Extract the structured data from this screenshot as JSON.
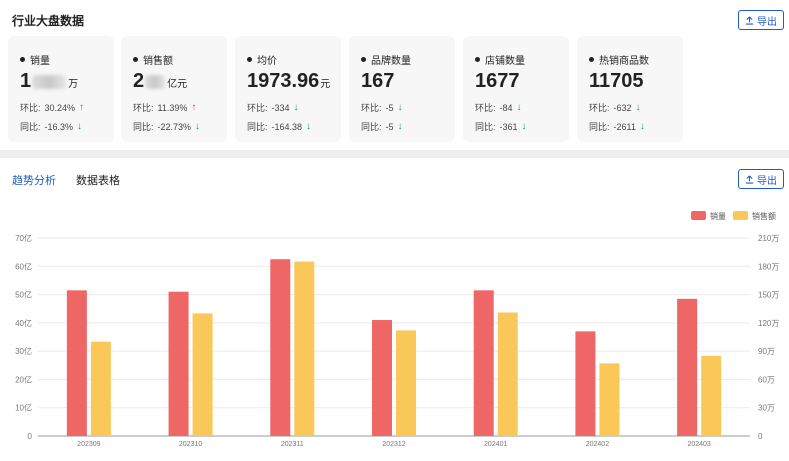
{
  "overview": {
    "title": "行业大盘数据",
    "export_label": "导出",
    "metrics": [
      {
        "name": "销量",
        "value_prefix": "1",
        "value_suffix": "",
        "unit": "万",
        "masked": true,
        "hb_label": "环比:",
        "hb_value": "30.24%",
        "hb_dir": "up",
        "tb_label": "同比:",
        "tb_value": "-16.3%",
        "tb_dir": "down"
      },
      {
        "name": "销售额",
        "value_prefix": "2",
        "value_suffix": "",
        "unit": "亿元",
        "masked": true,
        "hb_label": "环比:",
        "hb_value": "11.39%",
        "hb_dir": "up",
        "tb_label": "同比:",
        "tb_value": "-22.73%",
        "tb_dir": "down"
      },
      {
        "name": "均价",
        "value_prefix": "1973.96",
        "value_suffix": "",
        "unit": "元",
        "masked": false,
        "hb_label": "环比:",
        "hb_value": "-334",
        "hb_dir": "down",
        "tb_label": "同比:",
        "tb_value": "-164.38",
        "tb_dir": "down"
      },
      {
        "name": "品牌数量",
        "value_prefix": "167",
        "value_suffix": "",
        "unit": "",
        "masked": false,
        "hb_label": "环比:",
        "hb_value": "-5",
        "hb_dir": "down",
        "tb_label": "同比:",
        "tb_value": "-5",
        "tb_dir": "down"
      },
      {
        "name": "店铺数量",
        "value_prefix": "1677",
        "value_suffix": "",
        "unit": "",
        "masked": false,
        "hb_label": "环比:",
        "hb_value": "-84",
        "hb_dir": "down",
        "tb_label": "同比:",
        "tb_value": "-361",
        "tb_dir": "down"
      },
      {
        "name": "热销商品数",
        "value_prefix": "11705",
        "value_suffix": "",
        "unit": "",
        "masked": false,
        "hb_label": "环比:",
        "hb_value": "-632",
        "hb_dir": "down",
        "tb_label": "同比:",
        "tb_value": "-2611",
        "tb_dir": "down"
      }
    ]
  },
  "trend": {
    "tabs": [
      {
        "label": "趋势分析",
        "active": true
      },
      {
        "label": "数据表格",
        "active": false
      }
    ],
    "export_label": "导出"
  },
  "colors": {
    "accent": "#1f5cc4",
    "sales": "#ee6666",
    "revenue": "#fac858",
    "up": "#e53935",
    "down": "#16a34a"
  },
  "chart_data": {
    "type": "bar",
    "categories": [
      "202309",
      "202310",
      "202311",
      "202312",
      "202401",
      "202402",
      "202403"
    ],
    "series": [
      {
        "name": "销量",
        "axis": "left",
        "color": "#ee6666",
        "values": [
          51.5,
          51,
          62.5,
          41,
          51.5,
          37,
          48.5
        ]
      },
      {
        "name": "销售额",
        "axis": "right",
        "color": "#fac858",
        "values": [
          100,
          130,
          185,
          112,
          131,
          77,
          85
        ]
      }
    ],
    "y_left": {
      "ticks": [
        "0",
        "10亿",
        "20亿",
        "30亿",
        "40亿",
        "50亿",
        "60亿",
        "70亿"
      ],
      "range": [
        0,
        70
      ]
    },
    "y_right": {
      "ticks": [
        "0",
        "30万",
        "60万",
        "90万",
        "120万",
        "150万",
        "180万",
        "210万"
      ],
      "range": [
        0,
        210
      ]
    },
    "legend_position": "top-right",
    "grid": true
  }
}
